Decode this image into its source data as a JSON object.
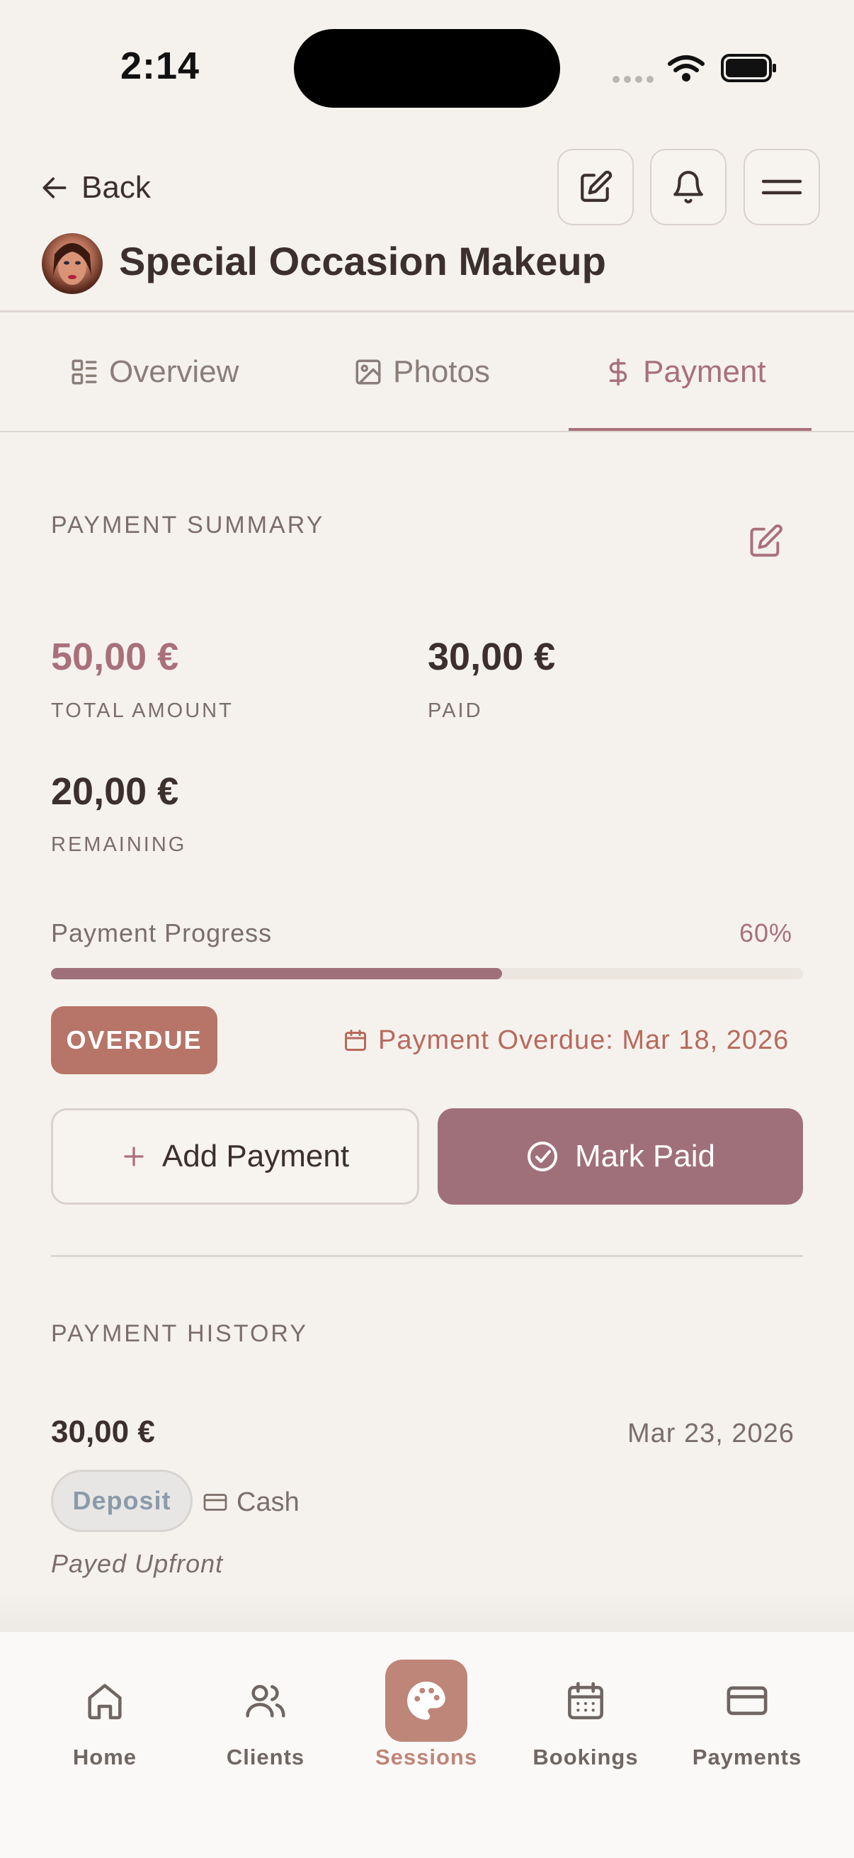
{
  "status_bar": {
    "time": "2:14"
  },
  "header": {
    "back_label": "Back",
    "title": "Special Occasion Makeup"
  },
  "tabs": [
    {
      "label": "Overview",
      "icon": "overview-icon",
      "active": false
    },
    {
      "label": "Photos",
      "icon": "photo-icon",
      "active": false
    },
    {
      "label": "Payment",
      "icon": "dollar-icon",
      "active": true
    }
  ],
  "summary": {
    "section_label": "PAYMENT SUMMARY",
    "total_amount": "50,00 €",
    "total_label": "TOTAL AMOUNT",
    "paid_amount": "30,00 €",
    "paid_label": "PAID",
    "remaining_amount": "20,00 €",
    "remaining_label": "REMAINING",
    "progress_label": "Payment Progress",
    "progress_text": "60%",
    "progress_fraction": 0.6,
    "overdue_badge": "OVERDUE",
    "overdue_text": "Payment Overdue: Mar 18, 2026",
    "add_payment_label": "Add Payment",
    "mark_paid_label": "Mark Paid"
  },
  "history": {
    "section_label": "PAYMENT HISTORY",
    "items": [
      {
        "amount": "30,00 €",
        "date": "Mar 23, 2026",
        "type": "Deposit",
        "method": "Cash",
        "note": "Payed Upfront"
      }
    ]
  },
  "nav": [
    {
      "label": "Home",
      "icon": "home-icon",
      "active": false
    },
    {
      "label": "Clients",
      "icon": "users-icon",
      "active": false
    },
    {
      "label": "Sessions",
      "icon": "palette-icon",
      "active": true
    },
    {
      "label": "Bookings",
      "icon": "calendar-icon",
      "active": false
    },
    {
      "label": "Payments",
      "icon": "credit-card-icon",
      "active": false
    }
  ],
  "colors": {
    "accent": "#a9707a",
    "overdue": "#b77468",
    "background": "#f5f2ee"
  }
}
